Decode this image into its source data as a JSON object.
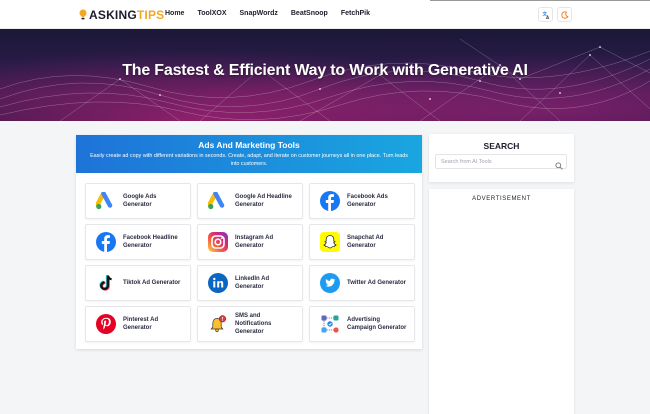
{
  "brand": {
    "part1": "ASKING",
    "part2": "TIPS"
  },
  "nav": {
    "items": [
      "Home",
      "ToolXOX",
      "SnapWordz",
      "BeatSnoop",
      "FetchPik"
    ]
  },
  "hero": {
    "title": "The Fastest & Efficient Way to Work with Generative AI"
  },
  "tools_section": {
    "title": "Ads And Marketing Tools",
    "description": "Easily create ad copy with different variations in seconds. Create, adapt, and iterate on customer journeys all in one place. Turn leads into customers.",
    "tools": [
      {
        "label": "Google Ads Generator",
        "icon": "google-ads-icon"
      },
      {
        "label": "Google Ad Headline Generator",
        "icon": "google-ads-icon"
      },
      {
        "label": "Facebook Ads Generator",
        "icon": "facebook-icon"
      },
      {
        "label": "Facebook Headline Generator",
        "icon": "facebook-icon"
      },
      {
        "label": "Instagram Ad Generator",
        "icon": "instagram-icon"
      },
      {
        "label": "Snapchat Ad Generator",
        "icon": "snapchat-icon"
      },
      {
        "label": "Tiktok Ad Generator",
        "icon": "tiktok-icon"
      },
      {
        "label": "LinkedIn Ad Generator",
        "icon": "linkedin-icon"
      },
      {
        "label": "Twitter Ad Generator",
        "icon": "twitter-icon"
      },
      {
        "label": "Pinterest Ad Generator",
        "icon": "pinterest-icon"
      },
      {
        "label": "SMS and Notifications Generator",
        "icon": "notification-bell-icon"
      },
      {
        "label": "Advertising Campaign Generator",
        "icon": "campaign-icon"
      }
    ]
  },
  "sidebar": {
    "search_title": "SEARCH",
    "search_placeholder": "Search from AI Tools",
    "ad_label": "ADVERTISEMENT"
  },
  "colors": {
    "brand_accent": "#f5a623",
    "header_gradient_start": "#1e73d8",
    "header_gradient_end": "#1aa6e0"
  }
}
